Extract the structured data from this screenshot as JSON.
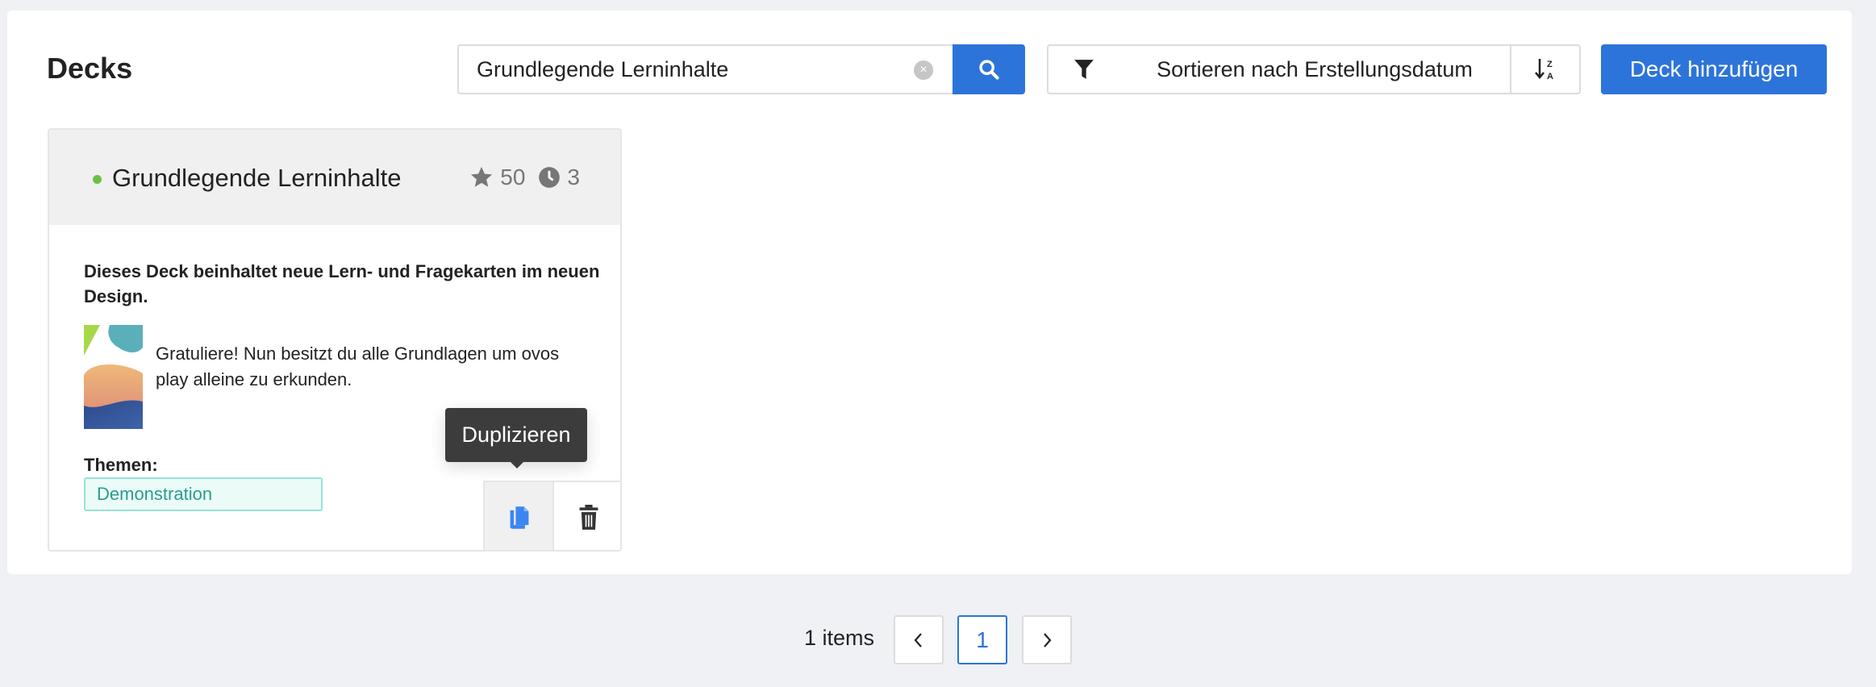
{
  "header": {
    "title": "Decks"
  },
  "search": {
    "value": "Grundlegende Lerninhalte",
    "search_icon": "magnifier-icon",
    "clear_icon": "clear-icon"
  },
  "toolbar": {
    "filter_icon": "funnel-icon",
    "sort_label": "Sortieren nach Erstellungsdatum",
    "sort_order_icon": "sort-z-a-icon",
    "add_label": "Deck hinzufügen"
  },
  "colors": {
    "accent": "#2d74da",
    "status_active": "#6cc04a",
    "tag_text": "#2c9b8d",
    "tag_bg": "#ebfcf8"
  },
  "deck": {
    "title": "Grundlegende Lerninhalte",
    "stars": "50",
    "pending": "3",
    "description": "Dieses Deck beinhaltet neue Lern- und Fragekarten im neuen Design.",
    "intro_text": "Gratuliere! Nun besitzt du alle Grundlagen um ovos play alleine zu erkunden.",
    "themes_label": "Themen:",
    "themes": [
      "Demonstration"
    ],
    "tooltip": "Duplizieren"
  },
  "pagination": {
    "summary": "1 items",
    "pages": [
      "1"
    ],
    "current": "1"
  }
}
